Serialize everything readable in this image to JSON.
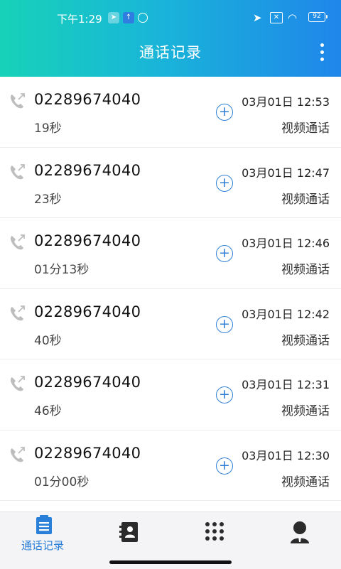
{
  "status_bar": {
    "time": "下午1:29",
    "battery": "92"
  },
  "header": {
    "title": "通话记录"
  },
  "calls": [
    {
      "number": "02289674040",
      "duration": "19秒",
      "time": "03月01日 12:53",
      "type": "视频通话"
    },
    {
      "number": "02289674040",
      "duration": "23秒",
      "time": "03月01日 12:47",
      "type": "视频通话"
    },
    {
      "number": "02289674040",
      "duration": "01分13秒",
      "time": "03月01日 12:46",
      "type": "视频通话"
    },
    {
      "number": "02289674040",
      "duration": "40秒",
      "time": "03月01日 12:42",
      "type": "视频通话"
    },
    {
      "number": "02289674040",
      "duration": "46秒",
      "time": "03月01日 12:31",
      "type": "视频通话"
    },
    {
      "number": "02289674040",
      "duration": "01分00秒",
      "time": "03月01日 12:30",
      "type": "视频通话"
    }
  ],
  "tabs": [
    {
      "label": "通话记录",
      "icon": "call-log-icon",
      "active": true
    },
    {
      "label": "",
      "icon": "contacts-icon",
      "active": false
    },
    {
      "label": "",
      "icon": "dialpad-icon",
      "active": false
    },
    {
      "label": "",
      "icon": "profile-icon",
      "active": false
    }
  ],
  "colors": {
    "accent": "#2a7fd9",
    "header_gradient_start": "#17d2b8",
    "header_gradient_end": "#1f86ea"
  }
}
